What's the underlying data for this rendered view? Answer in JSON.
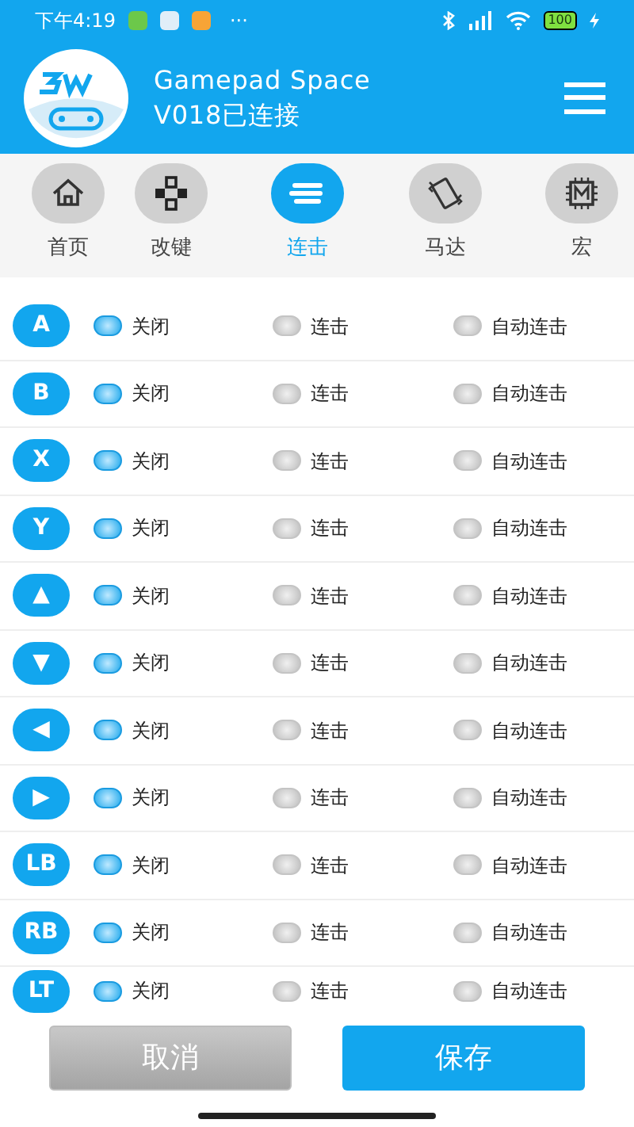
{
  "status_bar": {
    "time": "下午4:19",
    "more": "···",
    "battery": "100"
  },
  "header": {
    "title": "Gamepad Space",
    "subtitle": "V018已连接"
  },
  "tabs": [
    {
      "label": "首页",
      "kind": "home",
      "selected": false
    },
    {
      "label": "改键",
      "kind": "dpad",
      "selected": false
    },
    {
      "label": "连击",
      "kind": "turbo",
      "selected": true
    },
    {
      "label": "马达",
      "kind": "vibrate",
      "selected": false
    },
    {
      "label": "宏",
      "kind": "macro",
      "selected": false
    }
  ],
  "rows": [
    {
      "button": "A",
      "options": [
        {
          "label": "关闭",
          "selected": true
        },
        {
          "label": "连击",
          "selected": false
        },
        {
          "label": "自动连击",
          "selected": false
        }
      ]
    },
    {
      "button": "B",
      "options": [
        {
          "label": "关闭",
          "selected": true
        },
        {
          "label": "连击",
          "selected": false
        },
        {
          "label": "自动连击",
          "selected": false
        }
      ]
    },
    {
      "button": "X",
      "options": [
        {
          "label": "关闭",
          "selected": true
        },
        {
          "label": "连击",
          "selected": false
        },
        {
          "label": "自动连击",
          "selected": false
        }
      ]
    },
    {
      "button": "Y",
      "options": [
        {
          "label": "关闭",
          "selected": true
        },
        {
          "label": "连击",
          "selected": false
        },
        {
          "label": "自动连击",
          "selected": false
        }
      ]
    },
    {
      "button": "▲",
      "options": [
        {
          "label": "关闭",
          "selected": true
        },
        {
          "label": "连击",
          "selected": false
        },
        {
          "label": "自动连击",
          "selected": false
        }
      ]
    },
    {
      "button": "▼",
      "options": [
        {
          "label": "关闭",
          "selected": true
        },
        {
          "label": "连击",
          "selected": false
        },
        {
          "label": "自动连击",
          "selected": false
        }
      ]
    },
    {
      "button": "◀",
      "options": [
        {
          "label": "关闭",
          "selected": true
        },
        {
          "label": "连击",
          "selected": false
        },
        {
          "label": "自动连击",
          "selected": false
        }
      ]
    },
    {
      "button": "▶",
      "options": [
        {
          "label": "关闭",
          "selected": true
        },
        {
          "label": "连击",
          "selected": false
        },
        {
          "label": "自动连击",
          "selected": false
        }
      ]
    },
    {
      "button": "LB",
      "options": [
        {
          "label": "关闭",
          "selected": true
        },
        {
          "label": "连击",
          "selected": false
        },
        {
          "label": "自动连击",
          "selected": false
        }
      ]
    },
    {
      "button": "RB",
      "options": [
        {
          "label": "关闭",
          "selected": true
        },
        {
          "label": "连击",
          "selected": false
        },
        {
          "label": "自动连击",
          "selected": false
        }
      ]
    },
    {
      "button": "LT",
      "options": [
        {
          "label": "关闭",
          "selected": true
        },
        {
          "label": "连击",
          "selected": false
        },
        {
          "label": "自动连击",
          "selected": false
        }
      ]
    }
  ],
  "footer": {
    "cancel": "取消",
    "save": "保存"
  }
}
